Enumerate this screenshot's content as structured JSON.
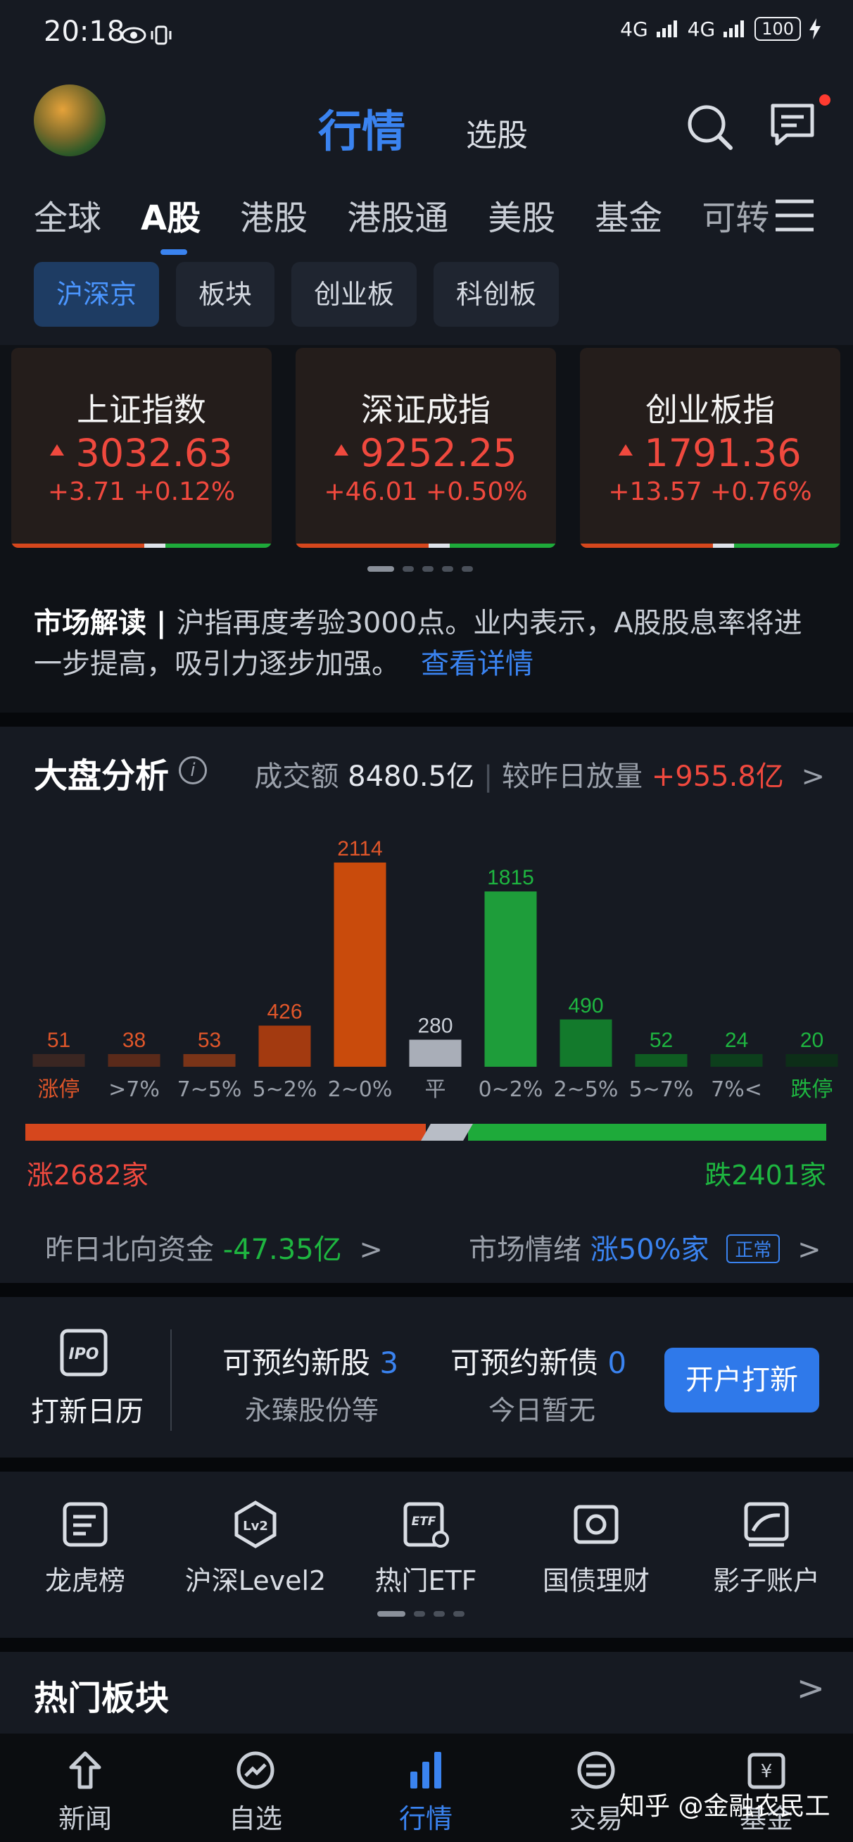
{
  "status": {
    "time": "20:18",
    "net1": "4G",
    "net2": "4G",
    "battery": "100"
  },
  "header": {
    "tab_main": "行情",
    "tab_sub": "选股"
  },
  "market_tabs": [
    "全球",
    "A股",
    "港股",
    "港股通",
    "美股",
    "基金",
    "可转"
  ],
  "sub_tabs": [
    "沪深京",
    "板块",
    "创业板",
    "科创板"
  ],
  "indices": [
    {
      "name": "上证指数",
      "value": "3032.63",
      "change": "+3.71 +0.12%"
    },
    {
      "name": "深证成指",
      "value": "9252.25",
      "change": "+46.01 +0.50%"
    },
    {
      "name": "创业板指",
      "value": "1791.36",
      "change": "+13.57 +0.76%"
    }
  ],
  "news": {
    "label": "市场解读",
    "text": "沪指再度考验3000点。业内表示，A股股息率将进一步提高，吸引力逐步加强。",
    "link": "查看详情"
  },
  "market_analysis": {
    "title": "大盘分析",
    "info_icon": "i",
    "turnover_label": "成交额",
    "turnover_value": "8480.5亿",
    "compare_label": "较昨日放量",
    "compare_value": "+955.8亿"
  },
  "chart_data": {
    "type": "bar",
    "categories": [
      "涨停",
      ">7%",
      "7~5%",
      "5~2%",
      "2~0%",
      "平",
      "0~2%",
      "2~5%",
      "5~7%",
      "7%<",
      "跌停"
    ],
    "values": [
      51,
      38,
      53,
      426,
      2114,
      280,
      1815,
      490,
      52,
      24,
      20
    ],
    "colors": [
      "#3a2622",
      "#5a2a1a",
      "#7a3418",
      "#a33a10",
      "#c94b0c",
      "#a9aeb8",
      "#1e9d3a",
      "#137a2c",
      "#0f5c22",
      "#0d3f1c",
      "#0d2e18"
    ],
    "label_colors": [
      "#e0562a",
      "#e0562a",
      "#e0562a",
      "#e0562a",
      "#e0562a",
      "#c9ced6",
      "#1eb640",
      "#1eb640",
      "#1eb640",
      "#1eb640",
      "#1eb640"
    ],
    "category_colors": [
      "#e0562a",
      "#9aa0aa",
      "#9aa0aa",
      "#9aa0aa",
      "#9aa0aa",
      "#9aa0aa",
      "#9aa0aa",
      "#9aa0aa",
      "#9aa0aa",
      "#9aa0aa",
      "#1eb640"
    ]
  },
  "breadth": {
    "up_label": "涨2682家",
    "down_label": "跌2401家",
    "up": 2682,
    "down": 2401
  },
  "northbound": {
    "label": "昨日北向资金",
    "value": "-47.35亿"
  },
  "sentiment": {
    "label": "市场情绪",
    "value": "涨50%家",
    "badge": "正常"
  },
  "ipo": {
    "calendar_label": "打新日历",
    "new_stock_label": "可预约新股",
    "new_stock_count": "3",
    "new_stock_sub": "永臻股份等",
    "new_bond_label": "可预约新债",
    "new_bond_count": "0",
    "new_bond_sub": "今日暂无",
    "button": "开户打新"
  },
  "tools": [
    "龙虎榜",
    "沪深Level2",
    "热门ETF",
    "国债理财",
    "影子账户"
  ],
  "hot_title": "热门板块",
  "nav": [
    "新闻",
    "自选",
    "行情",
    "交易",
    "基金"
  ],
  "watermark": "知乎 @金融农民工"
}
